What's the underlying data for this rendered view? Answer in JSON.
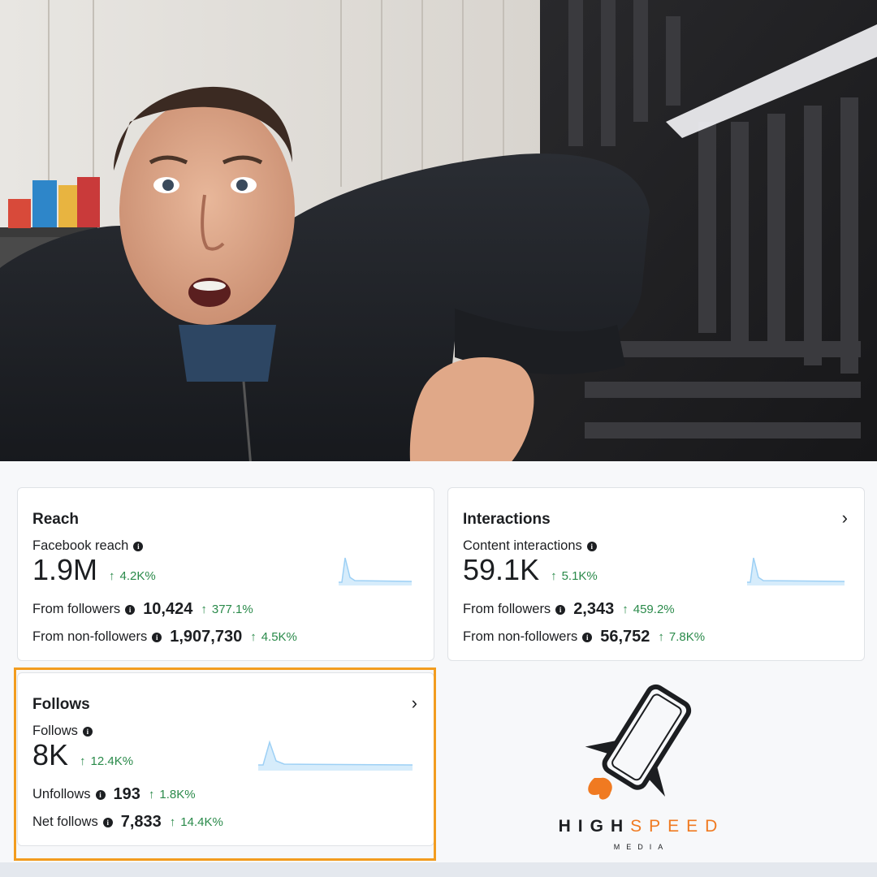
{
  "cards": {
    "reach": {
      "title": "Reach",
      "metric_label": "Facebook reach",
      "value": "1.9M",
      "delta": "4.2K%",
      "rows": [
        {
          "label": "From followers",
          "value": "10,424",
          "delta": "377.1%"
        },
        {
          "label": "From non-followers",
          "value": "1,907,730",
          "delta": "4.5K%"
        }
      ]
    },
    "interactions": {
      "title": "Interactions",
      "metric_label": "Content interactions",
      "value": "59.1K",
      "delta": "5.1K%",
      "rows": [
        {
          "label": "From followers",
          "value": "2,343",
          "delta": "459.2%"
        },
        {
          "label": "From non-followers",
          "value": "56,752",
          "delta": "7.8K%"
        }
      ]
    },
    "follows": {
      "title": "Follows",
      "metric_label": "Follows",
      "value": "8K",
      "delta": "12.4K%",
      "rows": [
        {
          "label": "Unfollows",
          "value": "193",
          "delta": "1.8K%"
        },
        {
          "label": "Net follows",
          "value": "7,833",
          "delta": "14.4K%"
        }
      ]
    }
  },
  "icons": {
    "info": "info-icon",
    "chevron": "chevron-right-icon",
    "up_arrow": "arrow-up-icon"
  },
  "glyphs": {
    "arrow": "↑",
    "chevron": "›",
    "info": "i"
  },
  "logo": {
    "word1": "HIGH",
    "word2": "SPEED",
    "word3": "MEDIA"
  },
  "colors": {
    "positive": "#2a8a4a",
    "highlight": "#f29c1f",
    "brand_orange": "#f07a21",
    "sparkline": "#9dd0f5"
  }
}
